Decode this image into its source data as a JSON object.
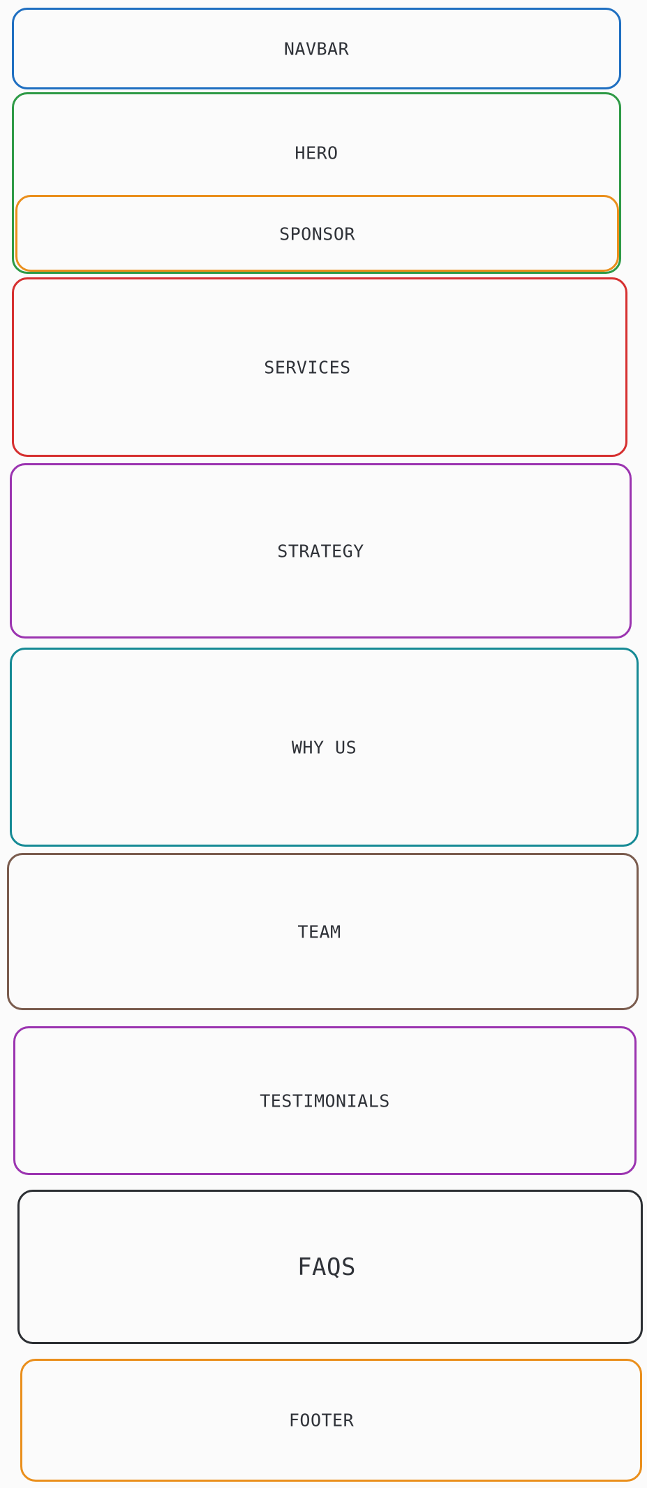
{
  "sections": {
    "navbar": "NAVBAR",
    "hero": "HERO",
    "sponsor": "SPONSOR",
    "services": "SERVICES",
    "strategy": "STRATEGY",
    "why_us": "WHY US",
    "team": "TEAM",
    "testimonials": "TESTIMONIALS",
    "faqs": "FAQS",
    "footer": "FOOTER"
  },
  "colors": {
    "navbar": "#1f6fc1",
    "hero": "#2e9a46",
    "sponsor": "#ea8f1c",
    "services": "#d63030",
    "strategy": "#9b34b0",
    "why_us": "#168a95",
    "team": "#7a5c4e",
    "testimonials": "#9b34b0",
    "faqs": "#2c2f33",
    "footer": "#ea8f1c"
  }
}
